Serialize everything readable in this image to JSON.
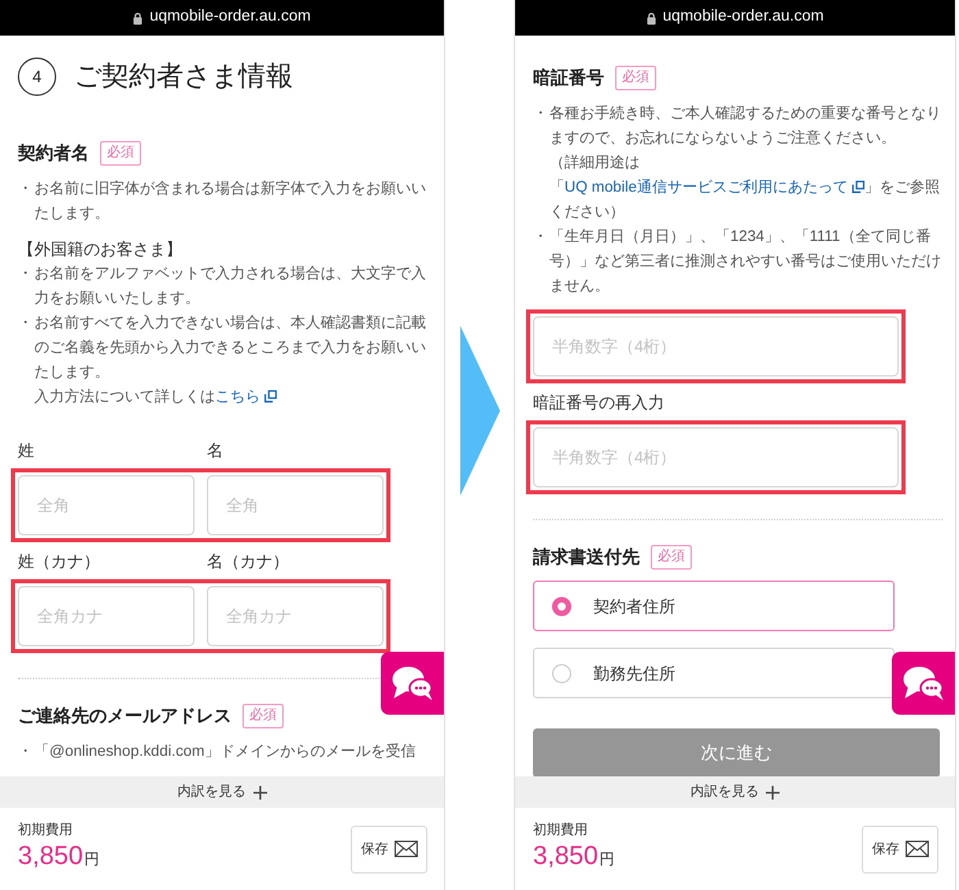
{
  "screens": [
    {
      "address_bar": {
        "url": "uqmobile-order.au.com"
      },
      "blocks": [
        {
          "kind": "step_title",
          "number": "4",
          "text": "ご契約者さま情報"
        },
        {
          "kind": "heading",
          "text": "契約者名",
          "badge": "必須"
        },
        {
          "kind": "notes",
          "lines": [
            {
              "bullet": "・",
              "parts": [
                {
                  "kind": "text",
                  "text": "お名前に旧字体が含まれる場合は新字体で入力をお願いいたします。"
                }
              ]
            }
          ]
        },
        {
          "kind": "subheading",
          "text": "【外国籍のお客さま】"
        },
        {
          "kind": "notes",
          "lines": [
            {
              "bullet": "・",
              "parts": [
                {
                  "kind": "text",
                  "text": "お名前をアルファベットで入力される場合は、大文字で入力をお願いいたします。"
                }
              ]
            },
            {
              "bullet": "・",
              "parts": [
                {
                  "kind": "text",
                  "text": "お名前すべてを入力できない場合は、本人確認書類に記載のご名義を先頭から入力できるところまで入力をお願いいたします。"
                }
              ]
            },
            {
              "parts": [
                {
                  "kind": "text",
                  "text": "入力方法について詳しくは"
                },
                {
                  "kind": "link",
                  "text": "こちら"
                }
              ]
            }
          ]
        },
        {
          "kind": "field_row",
          "highlighted": true,
          "fields": [
            {
              "label": "姓",
              "placeholder": "全角"
            },
            {
              "label": "名",
              "placeholder": "全角"
            }
          ]
        },
        {
          "kind": "field_row",
          "highlighted": true,
          "fields": [
            {
              "label": "姓（カナ）",
              "placeholder": "全角カナ"
            },
            {
              "label": "名（カナ）",
              "placeholder": "全角カナ"
            }
          ]
        },
        {
          "kind": "divider"
        },
        {
          "kind": "heading",
          "text": "ご連絡先のメールアドレス",
          "badge": "必須"
        },
        {
          "kind": "notes",
          "lines": [
            {
              "bullet": "・",
              "parts": [
                {
                  "kind": "text",
                  "text": "「@onlineshop.kddi.com」ドメインからのメールを受信"
                }
              ]
            }
          ]
        }
      ],
      "footer": {
        "breakdown_toggle": "内訳を見る",
        "fee_label": "初期費用",
        "price": "3,850",
        "currency": "円",
        "save_button": "保存"
      }
    },
    {
      "address_bar": {
        "url": "uqmobile-order.au.com"
      },
      "blocks": [
        {
          "kind": "heading",
          "text": "暗証番号",
          "badge": "必須"
        },
        {
          "kind": "notes",
          "lines": [
            {
              "bullet": "・",
              "parts": [
                {
                  "kind": "text",
                  "text": "各種お手続き時、ご本人確認するための重要な番号となりますので、お忘れにならないようご注意ください。"
                }
              ]
            },
            {
              "parts": [
                {
                  "kind": "text",
                  "text": "（詳細用途は「"
                },
                {
                  "kind": "link",
                  "text": "UQ mobile通信サービスご利用にあたって"
                },
                {
                  "kind": "text",
                  "text": "」をご参照ください）"
                }
              ]
            },
            {
              "bullet": "・",
              "parts": [
                {
                  "kind": "text",
                  "text": "「生年月日（月日）」、「1234」、「1111（全て同じ番号）」など第三者に推測されやすい番号はご使用いただけません。"
                }
              ]
            }
          ]
        },
        {
          "kind": "field_row",
          "highlighted": true,
          "fields": [
            {
              "placeholder": "半角数字（4桁）"
            }
          ]
        },
        {
          "kind": "field_row",
          "highlighted": true,
          "fields": [
            {
              "label": "暗証番号の再入力",
              "placeholder": "半角数字（4桁）"
            }
          ]
        },
        {
          "kind": "divider"
        },
        {
          "kind": "heading",
          "text": "請求書送付先",
          "badge": "必須"
        },
        {
          "kind": "radio_group",
          "options": [
            {
              "label": "契約者住所",
              "selected": true
            },
            {
              "label": "勤務先住所",
              "selected": false
            }
          ]
        },
        {
          "kind": "button",
          "label": "次に進む",
          "disabled": true
        }
      ],
      "footer": {
        "breakdown_toggle": "内訳を見る",
        "fee_label": "初期費用",
        "price": "3,850",
        "currency": "円",
        "save_button": "保存"
      }
    }
  ]
}
